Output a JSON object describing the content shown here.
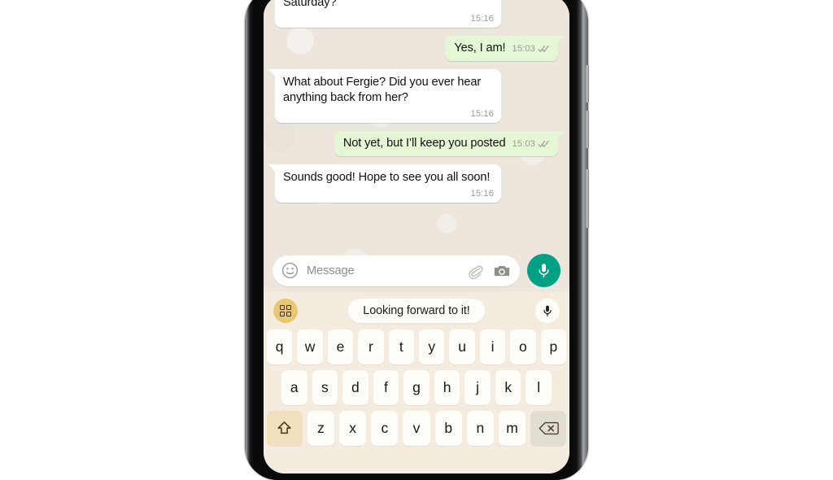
{
  "device": {
    "side_buttons": [
      "volume-up",
      "volume-down",
      "power"
    ]
  },
  "chat": {
    "messages": [
      {
        "direction": "incoming",
        "text": "Are you still landing in town this Saturday?",
        "time": "15:16",
        "status": "",
        "layout": "block"
      },
      {
        "direction": "outgoing",
        "text": "Yes, I am!",
        "time": "15:03",
        "status": "read",
        "layout": "inline"
      },
      {
        "direction": "incoming",
        "text": "What about Fergie? Did you ever hear anything back from her?",
        "time": "15:16",
        "status": "",
        "layout": "block"
      },
      {
        "direction": "outgoing",
        "text": "Not yet, but I’ll keep you posted",
        "time": "15:03",
        "status": "read",
        "layout": "inline"
      },
      {
        "direction": "incoming",
        "text": "Sounds good! Hope to see you all soon!",
        "time": "15:16",
        "status": "",
        "layout": "block"
      }
    ]
  },
  "input_bar": {
    "emoji_icon": "smiley-icon",
    "placeholder": "Message",
    "attach_icon": "paperclip-icon",
    "camera_icon": "camera-icon",
    "send_icon": "microphone-icon",
    "send_button_color": "#00a085"
  },
  "keyboard": {
    "toolbar": {
      "grid_icon": "grid-icon",
      "grid_button_color": "#e9c874",
      "suggestion": "Looking forward to it!",
      "mic_icon": "microphone-icon"
    },
    "row1": [
      "q",
      "w",
      "e",
      "r",
      "t",
      "y",
      "u",
      "i",
      "o",
      "p"
    ],
    "row2": [
      "a",
      "s",
      "d",
      "f",
      "g",
      "h",
      "j",
      "k",
      "l"
    ],
    "row3_shift_icon": "shift-icon",
    "row3": [
      "z",
      "x",
      "c",
      "v",
      "b",
      "n",
      "m"
    ],
    "row3_backspace_icon": "backspace-icon"
  },
  "colors": {
    "chat_background": "#ece6dd",
    "incoming_bubble": "#ffffff",
    "outgoing_bubble": "#e5f7d5",
    "keyboard_background": "#f5ece0",
    "key": "#fffdf8",
    "shift_key": "#f1dfbd",
    "backspace_key": "#e2ddd3"
  }
}
